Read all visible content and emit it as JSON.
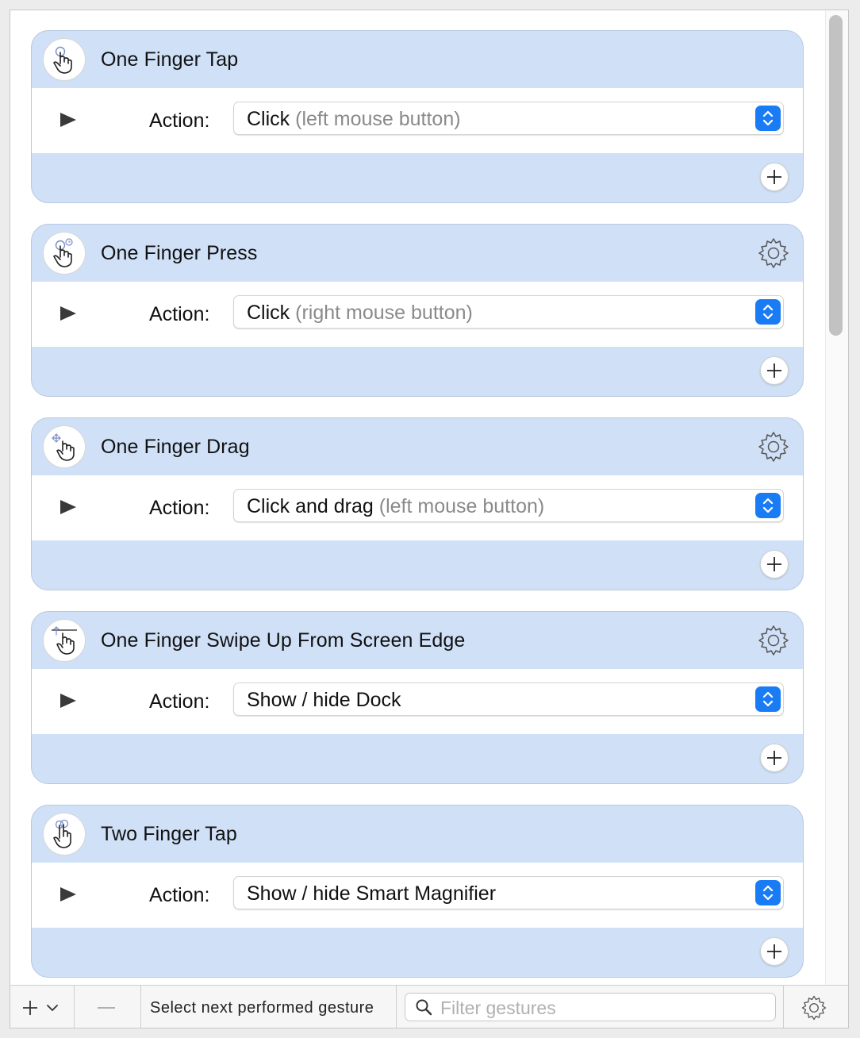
{
  "gestures": [
    {
      "title": "One Finger Tap",
      "icon": "one-finger-tap-icon",
      "has_settings": false,
      "action_label": "Action:",
      "action_main": "Click",
      "action_detail": "(left mouse button)"
    },
    {
      "title": "One Finger Press",
      "icon": "one-finger-press-icon",
      "has_settings": true,
      "action_label": "Action:",
      "action_main": "Click",
      "action_detail": "(right mouse button)"
    },
    {
      "title": "One Finger Drag",
      "icon": "one-finger-drag-icon",
      "has_settings": true,
      "action_label": "Action:",
      "action_main": "Click and drag",
      "action_detail": "(left mouse button)"
    },
    {
      "title": "One Finger Swipe Up From Screen Edge",
      "icon": "one-finger-swipe-up-icon",
      "has_settings": true,
      "action_label": "Action:",
      "action_main": "Show / hide Dock",
      "action_detail": ""
    },
    {
      "title": "Two Finger Tap",
      "icon": "two-finger-tap-icon",
      "has_settings": false,
      "action_label": "Action:",
      "action_main": "Show / hide Smart Magnifier",
      "action_detail": ""
    }
  ],
  "toolbar": {
    "select_next_label": "Select next performed gesture",
    "filter_placeholder": "Filter gestures",
    "filter_value": ""
  },
  "colors": {
    "card_bg": "#cfe0f7",
    "accent": "#1a7cf5"
  }
}
